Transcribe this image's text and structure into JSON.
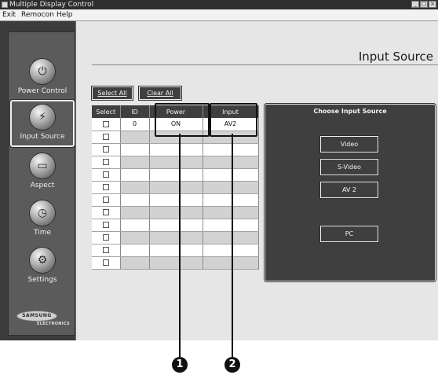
{
  "window": {
    "title": "Multiple Display Control"
  },
  "menu": [
    "Exit",
    "Remocon",
    "Help"
  ],
  "sidebar": {
    "items": [
      {
        "label": "Power Control",
        "icon": "power-control-icon"
      },
      {
        "label": "Input Source",
        "icon": "input-source-icon",
        "active": true
      },
      {
        "label": "Aspect",
        "icon": "aspect-icon"
      },
      {
        "label": "Time",
        "icon": "time-icon"
      },
      {
        "label": "Settings",
        "icon": "settings-icon"
      }
    ],
    "logo": {
      "text": "SAMSUNG",
      "sub": "ELECTRONICS"
    }
  },
  "main": {
    "page_title": "Input Source",
    "select_all": "Select All",
    "clear_all": "Clear All",
    "table": {
      "columns": [
        "Select",
        "ID",
        "Power",
        "Input"
      ],
      "rows": [
        {
          "id": "0",
          "power": "ON",
          "input": "AV2"
        },
        {
          "id": "",
          "power": "",
          "input": ""
        },
        {
          "id": "",
          "power": "",
          "input": ""
        },
        {
          "id": "",
          "power": "",
          "input": ""
        },
        {
          "id": "",
          "power": "",
          "input": ""
        },
        {
          "id": "",
          "power": "",
          "input": ""
        },
        {
          "id": "",
          "power": "",
          "input": ""
        },
        {
          "id": "",
          "power": "",
          "input": ""
        },
        {
          "id": "",
          "power": "",
          "input": ""
        },
        {
          "id": "",
          "power": "",
          "input": ""
        },
        {
          "id": "",
          "power": "",
          "input": ""
        },
        {
          "id": "",
          "power": "",
          "input": ""
        }
      ]
    },
    "panel": {
      "title": "Choose Input Source",
      "buttons": [
        "Video",
        "S-Video",
        "AV 2",
        "PC"
      ]
    }
  },
  "callouts": [
    "1",
    "2"
  ]
}
